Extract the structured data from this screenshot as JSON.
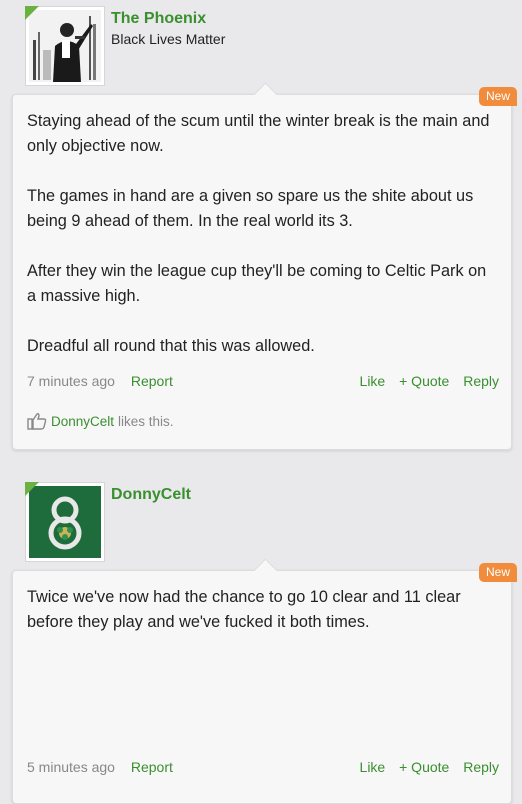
{
  "posts": [
    {
      "username": "The Phoenix",
      "user_title": "Black Lives Matter",
      "badge": "New",
      "paragraphs": [
        "Staying ahead of the scum until the winter break is the main and only objective now.",
        "The games in hand are a given so spare us the shite about us being 9 ahead of them. In the real world its 3.",
        "After they win the league cup they'll be coming to Celtic Park on a massive high.",
        "Dreadful all round that this was allowed."
      ],
      "time": "7 minutes ago",
      "report": "Report",
      "like": "Like",
      "quote": "+ Quote",
      "reply": "Reply",
      "liker": "DonnyCelt",
      "likes_suffix": "likes this."
    },
    {
      "username": "DonnyCelt",
      "badge": "New",
      "paragraphs": [
        "Twice we've now had the chance to go 10 clear and 11 clear before they play and we've fucked it both times."
      ],
      "time": "5 minutes ago",
      "report": "Report",
      "like": "Like",
      "quote": "+ Quote",
      "reply": "Reply"
    }
  ],
  "colors": {
    "accent": "#3a8f2f",
    "badge": "#f08c3c",
    "background": "#e9e9ec"
  }
}
